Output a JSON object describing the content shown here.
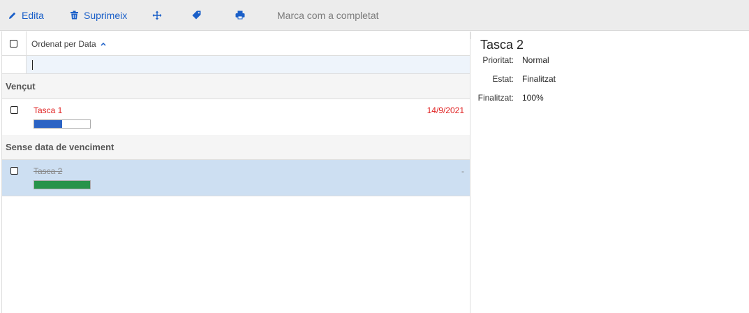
{
  "toolbar": {
    "edit_label": "Edita",
    "delete_label": "Suprimeix",
    "mark_complete_label": "Marca com a completat"
  },
  "list": {
    "sort_label": "Ordenat per Data",
    "filter_value": "",
    "groups": [
      {
        "title": "Vençut",
        "tasks": [
          {
            "name": "Tasca 1",
            "date": "14/9/2021",
            "progress": 0.5,
            "completed": false,
            "overdue": true,
            "selected": false
          }
        ]
      },
      {
        "title": "Sense data de venciment",
        "tasks": [
          {
            "name": "Tasca 2",
            "date": "-",
            "progress": 1.0,
            "completed": true,
            "overdue": false,
            "selected": true
          }
        ]
      }
    ]
  },
  "detail": {
    "title": "Tasca 2",
    "properties": [
      {
        "label": "Prioritat:",
        "value": "Normal"
      },
      {
        "label": "Estat:",
        "value": "Finalitzat"
      },
      {
        "label": "Finalitzat:",
        "value": "100%"
      }
    ]
  },
  "colors": {
    "accent": "#1a5fc8",
    "overdue_text": "#e02020",
    "progress_blue": "#2b63c4",
    "progress_green": "#27934a",
    "completed_text": "#888888",
    "selected_row": "#cddff2"
  }
}
